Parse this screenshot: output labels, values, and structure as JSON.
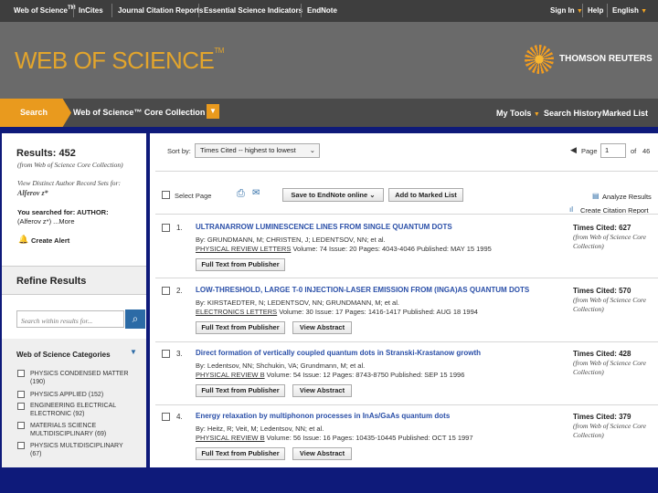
{
  "topbar": {
    "links": [
      "Web of Science",
      "InCites",
      "Journal Citation Reports",
      "Essential Science Indicators",
      "EndNote"
    ],
    "sign_in": "Sign In",
    "help": "Help",
    "language": "English"
  },
  "banner": {
    "logo": "WEB OF SCIENCE",
    "logo_tm": "TM",
    "publisher": "THOMSON REUTERS"
  },
  "nav": {
    "search_tab": "Search",
    "database": "Web of Science™ Core Collection",
    "my_tools": "My Tools",
    "search_history": "Search History",
    "marked_list": "Marked List"
  },
  "sidebar": {
    "results_label": "Results: 452",
    "results_source": "(from Web of Science Core Collection)",
    "author_sets_line1": "View Distinct Author Record Sets for:",
    "author_sets_name": "Alferov z*",
    "you_searched": "You searched for: AUTHOR:",
    "searched_query": "(Alferov z*) ...More",
    "create_alert": "Create Alert",
    "refine_heading": "Refine Results",
    "refine_placeholder": "Search within results for...",
    "categories_heading": "Web of Science Categories",
    "categories": [
      {
        "line1": "PHYSICS CONDENSED MATTER",
        "line2": "(190)"
      },
      {
        "line1": "PHYSICS APPLIED (152)",
        "line2": ""
      },
      {
        "line1": "ENGINEERING ELECTRICAL",
        "line2": "ELECTRONIC (92)"
      },
      {
        "line1": "MATERIALS SCIENCE",
        "line2": "MULTIDISCIPLINARY (69)"
      },
      {
        "line1": "PHYSICS MULTIDISCIPLINARY",
        "line2": "(67)"
      }
    ]
  },
  "toolbar": {
    "sort_label": "Sort by:",
    "sort_value": "Times Cited -- highest to lowest",
    "page_label": "Page",
    "page_value": "1",
    "page_of": "of",
    "page_total": "46",
    "select_page": "Select Page",
    "save_endnote": "Save to EndNote online",
    "add_marked": "Add to Marked List",
    "analyze": "Analyze Results",
    "citation_report": "Create Citation Report"
  },
  "records": [
    {
      "num": "1.",
      "title": "ULTRANARROW LUMINESCENCE LINES FROM SINGLE QUANTUM DOTS",
      "authors": "By: GRUNDMANN, M; CHRISTEN, J; LEDENTSOV, NN; et al.",
      "journal": "PHYSICAL REVIEW LETTERS",
      "details": "Volume: 74   Issue: 20   Pages: 4043-4046   Published: MAY 15 1995",
      "buttons": [
        "Full Text from Publisher"
      ],
      "times_cited": "Times Cited: 627",
      "cited_source": "(from Web of Science Core Collection)"
    },
    {
      "num": "2.",
      "title": "LOW-THRESHOLD, LARGE T-0 INJECTION-LASER EMISSION FROM (INGA)AS QUANTUM DOTS",
      "authors": "By: KIRSTAEDTER, N; LEDENTSOV, NN; GRUNDMANN, M; et al.",
      "journal": "ELECTRONICS LETTERS",
      "details": "Volume: 30   Issue: 17   Pages: 1416-1417   Published: AUG 18 1994",
      "buttons": [
        "Full Text from Publisher",
        "View Abstract"
      ],
      "times_cited": "Times Cited: 570",
      "cited_source": "(from Web of Science Core Collection)"
    },
    {
      "num": "3.",
      "title": "Direct formation of vertically coupled quantum dots in Stranski-Krastanow growth",
      "authors": "By: Ledentsov, NN; Shchukin, VA; Grundmann, M; et al.",
      "journal": "PHYSICAL REVIEW B",
      "details": "Volume: 54   Issue: 12   Pages: 8743-8750   Published: SEP 15 1996",
      "buttons": [
        "Full Text from Publisher",
        "View Abstract"
      ],
      "times_cited": "Times Cited: 428",
      "cited_source": "(from Web of Science Core Collection)"
    },
    {
      "num": "4.",
      "title": "Energy relaxation by multiphonon processes in InAs/GaAs quantum dots",
      "authors": "By: Heitz, R; Veit, M; Ledentsov, NN; et al.",
      "journal": "PHYSICAL REVIEW B",
      "details": "Volume: 56   Issue: 16   Pages: 10435-10445   Published: OCT 15 1997",
      "buttons": [
        "Full Text from Publisher",
        "View Abstract"
      ],
      "times_cited": "Times Cited: 379",
      "cited_source": "(from Web of Science Core Collection)"
    }
  ]
}
